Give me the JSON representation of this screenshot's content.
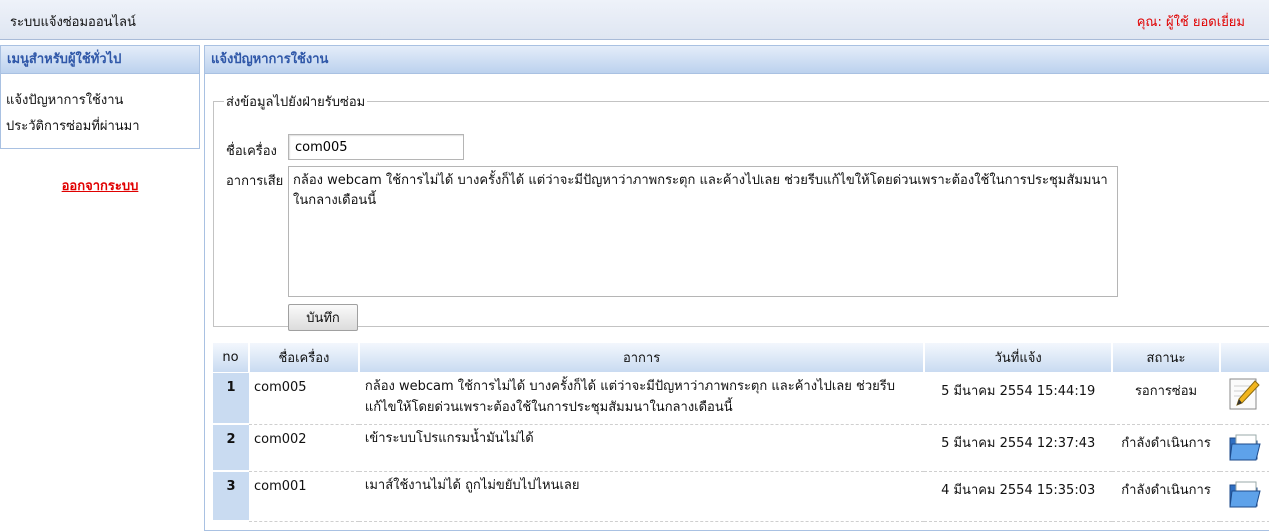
{
  "header": {
    "app_title": "ระบบแจ้งซ่อมออนไลน์",
    "user_label": "คุณ: ผู้ใช้ ยอดเยี่ยม"
  },
  "sidebar": {
    "title": "เมนูสำหรับผู้ใช้ทั่วไป",
    "items": [
      {
        "label": "แจ้งปัญหาการใช้งาน"
      },
      {
        "label": "ประวัติการซ่อมที่ผ่านมา"
      }
    ],
    "logout_label": "ออกจากระบบ"
  },
  "main": {
    "title": "แจ้งปัญหาการใช้งาน",
    "form": {
      "legend": "ส่งข้อมูลไปยังฝ่ายรับซ่อม",
      "host_label": "ชื่อเครื่อง",
      "host_value": "com005",
      "symptom_label": "อาการเสีย",
      "symptom_value": "กล้อง webcam ใช้การไม่ได้ บางครั้งก็ได้ แต่ว่าจะมีปัญหาว่าภาพกระตุก และค้างไปเลย ช่วยรีบแก้ไขให้โดยด่วนเพราะต้องใช้ในการประชุมสัมมนาในกลางเดือนนี้",
      "save_label": "บันทึก"
    },
    "table": {
      "columns": [
        "no",
        "ชื่อเครื่อง",
        "อาการ",
        "วันที่แจ้ง",
        "สถานะ",
        ""
      ],
      "rows": [
        {
          "no": "1",
          "host": "com005",
          "symptom": "กล้อง webcam ใช้การไม่ได้ บางครั้งก็ได้ แต่ว่าจะมีปัญหาว่าภาพกระตุก และค้างไปเลย ช่วยรีบแก้ไขให้โดยด่วนเพราะต้องใช้ในการประชุมสัมมนาในกลางเดือนนี้",
          "date": "5 มีนาคม 2554 15:44:19",
          "status": "รอการซ่อม",
          "icon": "edit-pencil-icon"
        },
        {
          "no": "2",
          "host": "com002",
          "symptom": "เข้าระบบโปรแกรมน้ำมันไม่ได้",
          "date": "5 มีนาคม 2554 12:37:43",
          "status": "กำลังดำเนินการ",
          "icon": "open-folder-icon"
        },
        {
          "no": "3",
          "host": "com001",
          "symptom": "เมาส์ใช้งานไม่ได้ ถูกไม่ขยับไปไหนเลย",
          "date": "4 มีนาคม 2554 15:35:03",
          "status": "กำลังดำเนินการ",
          "icon": "open-folder-icon"
        }
      ]
    }
  },
  "colors": {
    "accent_blue": "#2f57a8",
    "header_gradient_light": "#e4edf9",
    "header_gradient_dark": "#bcd2ee",
    "alert_red": "#e00000"
  }
}
